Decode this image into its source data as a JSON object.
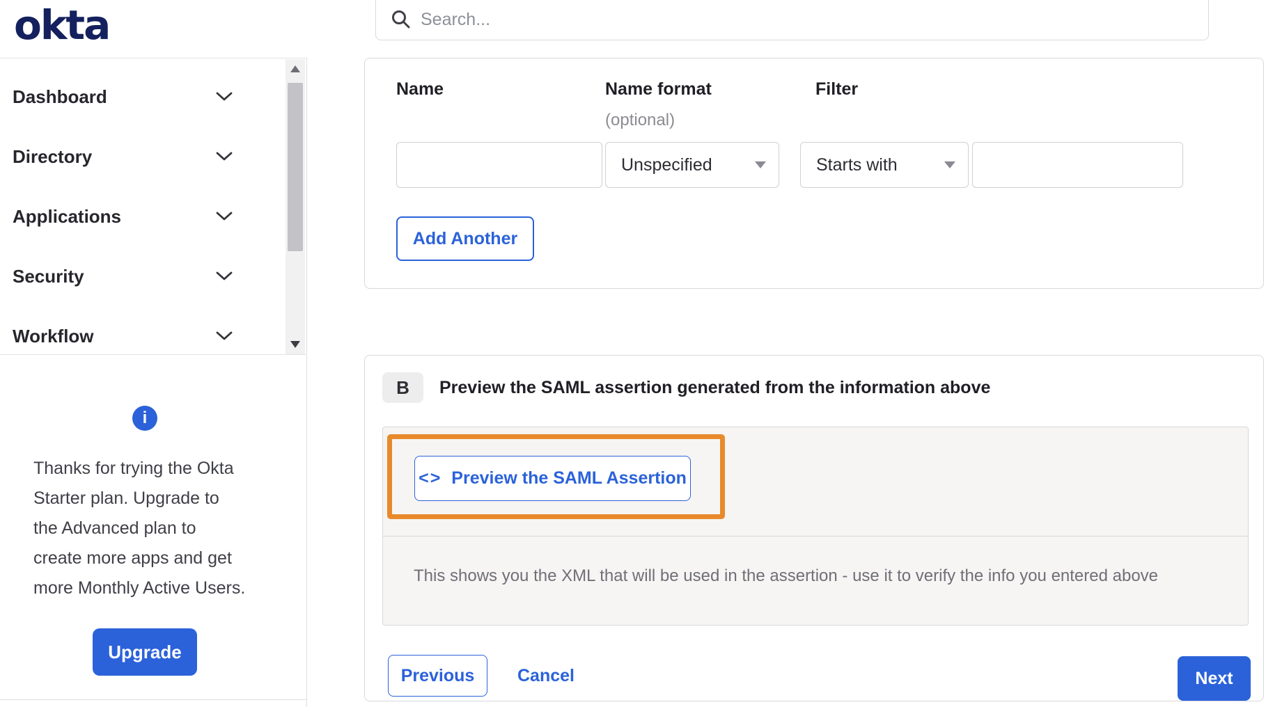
{
  "header": {
    "logo_text": "okta",
    "search": {
      "placeholder": "Search..."
    }
  },
  "sidebar": {
    "items": [
      {
        "label": "Dashboard"
      },
      {
        "label": "Directory"
      },
      {
        "label": "Applications"
      },
      {
        "label": "Security"
      },
      {
        "label": "Workflow"
      }
    ],
    "upgrade": {
      "info_glyph": "i",
      "message_lines": [
        "Thanks for trying the Okta",
        "Starter plan. Upgrade to",
        "the Advanced plan to",
        "create more apps and get",
        "more Monthly Active Users."
      ],
      "button_label": "Upgrade"
    }
  },
  "main": {
    "attribute_form": {
      "name_label": "Name",
      "name_format_label": "Name format",
      "name_format_hint": "(optional)",
      "filter_label": "Filter",
      "name_value": "",
      "name_format_selected": "Unspecified",
      "filter_type_selected": "Starts with",
      "filter_value": "",
      "add_another_label": "Add Another"
    },
    "section_b": {
      "badge": "B",
      "title": "Preview the SAML assertion generated from the information above",
      "preview_button": {
        "code_icon": "<>",
        "label": "Preview the SAML Assertion"
      },
      "description": "This shows you the XML that will be used in the assertion - use it to verify the info you entered above"
    },
    "footer": {
      "previous_label": "Previous",
      "cancel_label": "Cancel",
      "next_label": "Next"
    }
  },
  "colors": {
    "accent_blue": "#2b62d9",
    "logo_navy": "#14215e",
    "highlight_orange": "#e88a2c"
  }
}
